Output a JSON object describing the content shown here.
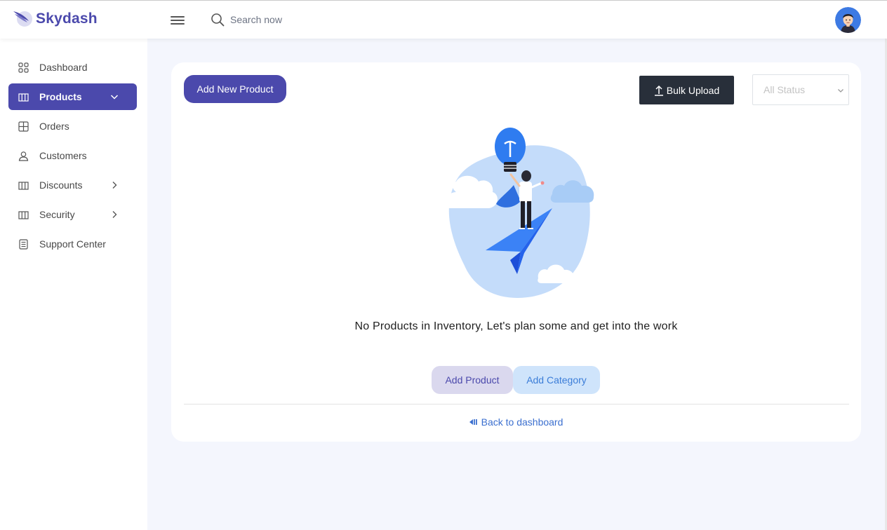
{
  "brand": {
    "name": "Skydash"
  },
  "search": {
    "placeholder": "Search now"
  },
  "sidebar": {
    "items": [
      {
        "label": "Dashboard",
        "icon": "grid-icon",
        "active": false,
        "has_children": false
      },
      {
        "label": "Products",
        "icon": "columns-icon",
        "active": true,
        "has_children": true,
        "expanded": true
      },
      {
        "label": "Orders",
        "icon": "table-icon",
        "active": false,
        "has_children": false
      },
      {
        "label": "Customers",
        "icon": "user-icon",
        "active": false,
        "has_children": false
      },
      {
        "label": "Discounts",
        "icon": "columns-icon",
        "active": false,
        "has_children": true,
        "expanded": false
      },
      {
        "label": "Security",
        "icon": "columns-icon",
        "active": false,
        "has_children": true,
        "expanded": false
      },
      {
        "label": "Support Center",
        "icon": "document-icon",
        "active": false,
        "has_children": false
      }
    ]
  },
  "toolbar": {
    "add_new_product": "Add New Product",
    "bulk_upload": "Bulk Upload",
    "status_select": {
      "value": "All Status"
    }
  },
  "empty_state": {
    "message": "No Products in Inventory, Let's plan some and get into the work",
    "add_product": "Add Product",
    "add_category": "Add Category",
    "back_link": "Back to dashboard"
  },
  "colors": {
    "brand": "#4b49ac",
    "dark_button": "#282f3a",
    "background": "#f4f6fd",
    "link": "#3b6fcf"
  }
}
